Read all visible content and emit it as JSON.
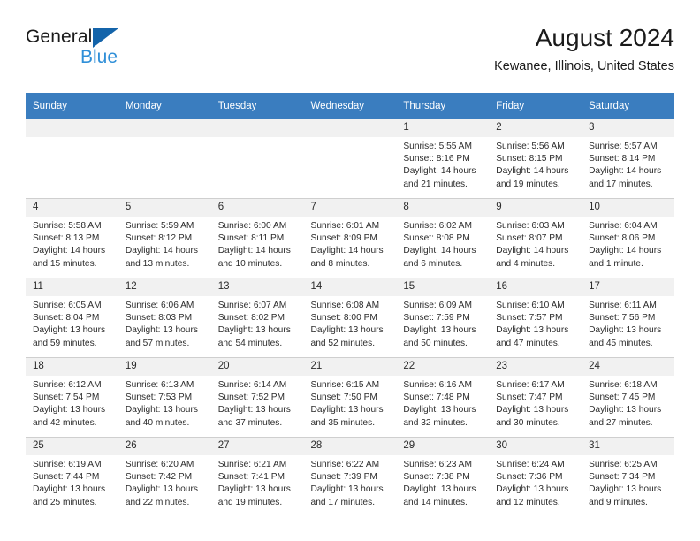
{
  "brand": {
    "name_part1": "General",
    "name_part2": "Blue"
  },
  "header": {
    "title": "August 2024",
    "subtitle": "Kewanee, Illinois, United States"
  },
  "columns": [
    "Sunday",
    "Monday",
    "Tuesday",
    "Wednesday",
    "Thursday",
    "Friday",
    "Saturday"
  ],
  "labels": {
    "sunrise": "Sunrise:",
    "sunset": "Sunset:",
    "daylight": "Daylight:"
  },
  "colors": {
    "header_row": "#3a7dbf",
    "daynum_band": "#f1f1f1",
    "brand_blue": "#2f8fd8",
    "brand_triangle": "#1464aa",
    "grid_line": "#cfcfcf"
  },
  "weeks": [
    [
      {
        "day": "",
        "empty": true
      },
      {
        "day": "",
        "empty": true
      },
      {
        "day": "",
        "empty": true
      },
      {
        "day": "",
        "empty": true
      },
      {
        "day": "1",
        "sunrise": "Sunrise: 5:55 AM",
        "sunset": "Sunset: 8:16 PM",
        "daylight_1": "Daylight: 14 hours",
        "daylight_2": "and 21 minutes."
      },
      {
        "day": "2",
        "sunrise": "Sunrise: 5:56 AM",
        "sunset": "Sunset: 8:15 PM",
        "daylight_1": "Daylight: 14 hours",
        "daylight_2": "and 19 minutes."
      },
      {
        "day": "3",
        "sunrise": "Sunrise: 5:57 AM",
        "sunset": "Sunset: 8:14 PM",
        "daylight_1": "Daylight: 14 hours",
        "daylight_2": "and 17 minutes."
      }
    ],
    [
      {
        "day": "4",
        "sunrise": "Sunrise: 5:58 AM",
        "sunset": "Sunset: 8:13 PM",
        "daylight_1": "Daylight: 14 hours",
        "daylight_2": "and 15 minutes."
      },
      {
        "day": "5",
        "sunrise": "Sunrise: 5:59 AM",
        "sunset": "Sunset: 8:12 PM",
        "daylight_1": "Daylight: 14 hours",
        "daylight_2": "and 13 minutes."
      },
      {
        "day": "6",
        "sunrise": "Sunrise: 6:00 AM",
        "sunset": "Sunset: 8:11 PM",
        "daylight_1": "Daylight: 14 hours",
        "daylight_2": "and 10 minutes."
      },
      {
        "day": "7",
        "sunrise": "Sunrise: 6:01 AM",
        "sunset": "Sunset: 8:09 PM",
        "daylight_1": "Daylight: 14 hours",
        "daylight_2": "and 8 minutes."
      },
      {
        "day": "8",
        "sunrise": "Sunrise: 6:02 AM",
        "sunset": "Sunset: 8:08 PM",
        "daylight_1": "Daylight: 14 hours",
        "daylight_2": "and 6 minutes."
      },
      {
        "day": "9",
        "sunrise": "Sunrise: 6:03 AM",
        "sunset": "Sunset: 8:07 PM",
        "daylight_1": "Daylight: 14 hours",
        "daylight_2": "and 4 minutes."
      },
      {
        "day": "10",
        "sunrise": "Sunrise: 6:04 AM",
        "sunset": "Sunset: 8:06 PM",
        "daylight_1": "Daylight: 14 hours",
        "daylight_2": "and 1 minute."
      }
    ],
    [
      {
        "day": "11",
        "sunrise": "Sunrise: 6:05 AM",
        "sunset": "Sunset: 8:04 PM",
        "daylight_1": "Daylight: 13 hours",
        "daylight_2": "and 59 minutes."
      },
      {
        "day": "12",
        "sunrise": "Sunrise: 6:06 AM",
        "sunset": "Sunset: 8:03 PM",
        "daylight_1": "Daylight: 13 hours",
        "daylight_2": "and 57 minutes."
      },
      {
        "day": "13",
        "sunrise": "Sunrise: 6:07 AM",
        "sunset": "Sunset: 8:02 PM",
        "daylight_1": "Daylight: 13 hours",
        "daylight_2": "and 54 minutes."
      },
      {
        "day": "14",
        "sunrise": "Sunrise: 6:08 AM",
        "sunset": "Sunset: 8:00 PM",
        "daylight_1": "Daylight: 13 hours",
        "daylight_2": "and 52 minutes."
      },
      {
        "day": "15",
        "sunrise": "Sunrise: 6:09 AM",
        "sunset": "Sunset: 7:59 PM",
        "daylight_1": "Daylight: 13 hours",
        "daylight_2": "and 50 minutes."
      },
      {
        "day": "16",
        "sunrise": "Sunrise: 6:10 AM",
        "sunset": "Sunset: 7:57 PM",
        "daylight_1": "Daylight: 13 hours",
        "daylight_2": "and 47 minutes."
      },
      {
        "day": "17",
        "sunrise": "Sunrise: 6:11 AM",
        "sunset": "Sunset: 7:56 PM",
        "daylight_1": "Daylight: 13 hours",
        "daylight_2": "and 45 minutes."
      }
    ],
    [
      {
        "day": "18",
        "sunrise": "Sunrise: 6:12 AM",
        "sunset": "Sunset: 7:54 PM",
        "daylight_1": "Daylight: 13 hours",
        "daylight_2": "and 42 minutes."
      },
      {
        "day": "19",
        "sunrise": "Sunrise: 6:13 AM",
        "sunset": "Sunset: 7:53 PM",
        "daylight_1": "Daylight: 13 hours",
        "daylight_2": "and 40 minutes."
      },
      {
        "day": "20",
        "sunrise": "Sunrise: 6:14 AM",
        "sunset": "Sunset: 7:52 PM",
        "daylight_1": "Daylight: 13 hours",
        "daylight_2": "and 37 minutes."
      },
      {
        "day": "21",
        "sunrise": "Sunrise: 6:15 AM",
        "sunset": "Sunset: 7:50 PM",
        "daylight_1": "Daylight: 13 hours",
        "daylight_2": "and 35 minutes."
      },
      {
        "day": "22",
        "sunrise": "Sunrise: 6:16 AM",
        "sunset": "Sunset: 7:48 PM",
        "daylight_1": "Daylight: 13 hours",
        "daylight_2": "and 32 minutes."
      },
      {
        "day": "23",
        "sunrise": "Sunrise: 6:17 AM",
        "sunset": "Sunset: 7:47 PM",
        "daylight_1": "Daylight: 13 hours",
        "daylight_2": "and 30 minutes."
      },
      {
        "day": "24",
        "sunrise": "Sunrise: 6:18 AM",
        "sunset": "Sunset: 7:45 PM",
        "daylight_1": "Daylight: 13 hours",
        "daylight_2": "and 27 minutes."
      }
    ],
    [
      {
        "day": "25",
        "sunrise": "Sunrise: 6:19 AM",
        "sunset": "Sunset: 7:44 PM",
        "daylight_1": "Daylight: 13 hours",
        "daylight_2": "and 25 minutes."
      },
      {
        "day": "26",
        "sunrise": "Sunrise: 6:20 AM",
        "sunset": "Sunset: 7:42 PM",
        "daylight_1": "Daylight: 13 hours",
        "daylight_2": "and 22 minutes."
      },
      {
        "day": "27",
        "sunrise": "Sunrise: 6:21 AM",
        "sunset": "Sunset: 7:41 PM",
        "daylight_1": "Daylight: 13 hours",
        "daylight_2": "and 19 minutes."
      },
      {
        "day": "28",
        "sunrise": "Sunrise: 6:22 AM",
        "sunset": "Sunset: 7:39 PM",
        "daylight_1": "Daylight: 13 hours",
        "daylight_2": "and 17 minutes."
      },
      {
        "day": "29",
        "sunrise": "Sunrise: 6:23 AM",
        "sunset": "Sunset: 7:38 PM",
        "daylight_1": "Daylight: 13 hours",
        "daylight_2": "and 14 minutes."
      },
      {
        "day": "30",
        "sunrise": "Sunrise: 6:24 AM",
        "sunset": "Sunset: 7:36 PM",
        "daylight_1": "Daylight: 13 hours",
        "daylight_2": "and 12 minutes."
      },
      {
        "day": "31",
        "sunrise": "Sunrise: 6:25 AM",
        "sunset": "Sunset: 7:34 PM",
        "daylight_1": "Daylight: 13 hours",
        "daylight_2": "and 9 minutes."
      }
    ]
  ]
}
